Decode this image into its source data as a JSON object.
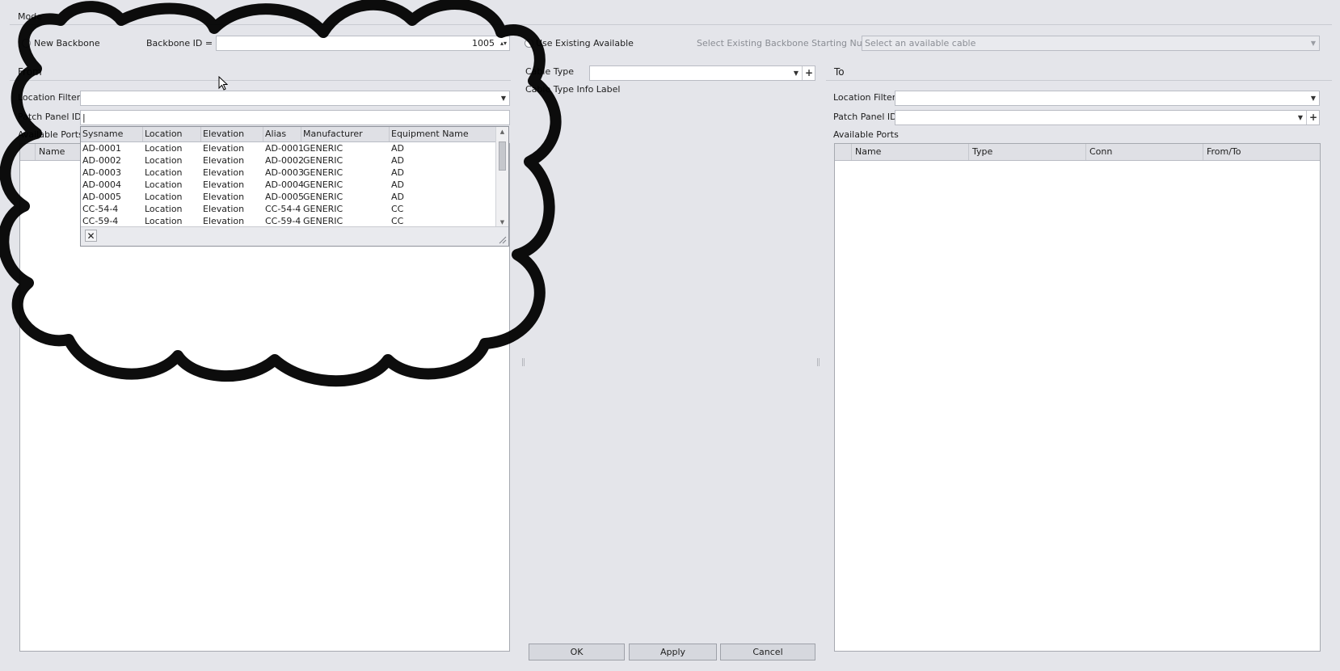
{
  "top": {
    "mode_label": "Mode",
    "new_backbone_label": "New Backbone",
    "backbone_id_label": "Backbone ID = B",
    "backbone_id_value": "1005",
    "use_existing_label": "Use Existing Available",
    "existing_start_label": "Select Existing Backbone Starting Number",
    "existing_start_placeholder": "Select an available cable"
  },
  "from": {
    "title": "From",
    "location_filter_label": "Location Filter",
    "location_filter_value": "",
    "patch_panel_label": "Patch Panel ID",
    "patch_panel_value": "",
    "available_ports_label": "Available Ports",
    "columns": [
      "Name"
    ]
  },
  "middle": {
    "cable_type_label": "Cable Type",
    "cable_type_value": "",
    "cable_info_label": "Cable Type Info Label",
    "ok_label": "OK",
    "apply_label": "Apply",
    "cancel_label": "Cancel"
  },
  "to": {
    "title": "To",
    "location_filter_label": "Location Filter",
    "location_filter_value": "",
    "patch_panel_label": "Patch Panel ID",
    "patch_panel_value": "",
    "available_ports_label": "Available Ports",
    "columns": [
      "Name",
      "Type",
      "Conn",
      "From/To"
    ]
  },
  "popup": {
    "columns": [
      "Sysname",
      "Location",
      "Elevation",
      "Alias",
      "Manufacturer",
      "Equipment Name"
    ],
    "rows": [
      [
        "AD-0001",
        "Location",
        "Elevation",
        "AD-0001",
        "GENERIC",
        "AD"
      ],
      [
        "AD-0002",
        "Location",
        "Elevation",
        "AD-0002",
        "GENERIC",
        "AD"
      ],
      [
        "AD-0003",
        "Location",
        "Elevation",
        "AD-0003",
        "GENERIC",
        "AD"
      ],
      [
        "AD-0004",
        "Location",
        "Elevation",
        "AD-0004",
        "GENERIC",
        "AD"
      ],
      [
        "AD-0005",
        "Location",
        "Elevation",
        "AD-0005",
        "GENERIC",
        "AD"
      ],
      [
        "CC-54-4",
        "Location",
        "Elevation",
        "CC-54-4",
        "GENERIC",
        "CC"
      ],
      [
        "CC-59-4",
        "Location",
        "Elevation",
        "CC-59-4",
        "GENERIC",
        "CC"
      ]
    ]
  },
  "icons": {
    "dropdown": "chevron-down-icon",
    "add": "plus-icon",
    "close": "close-icon",
    "cursor": "mouse-pointer-icon"
  }
}
